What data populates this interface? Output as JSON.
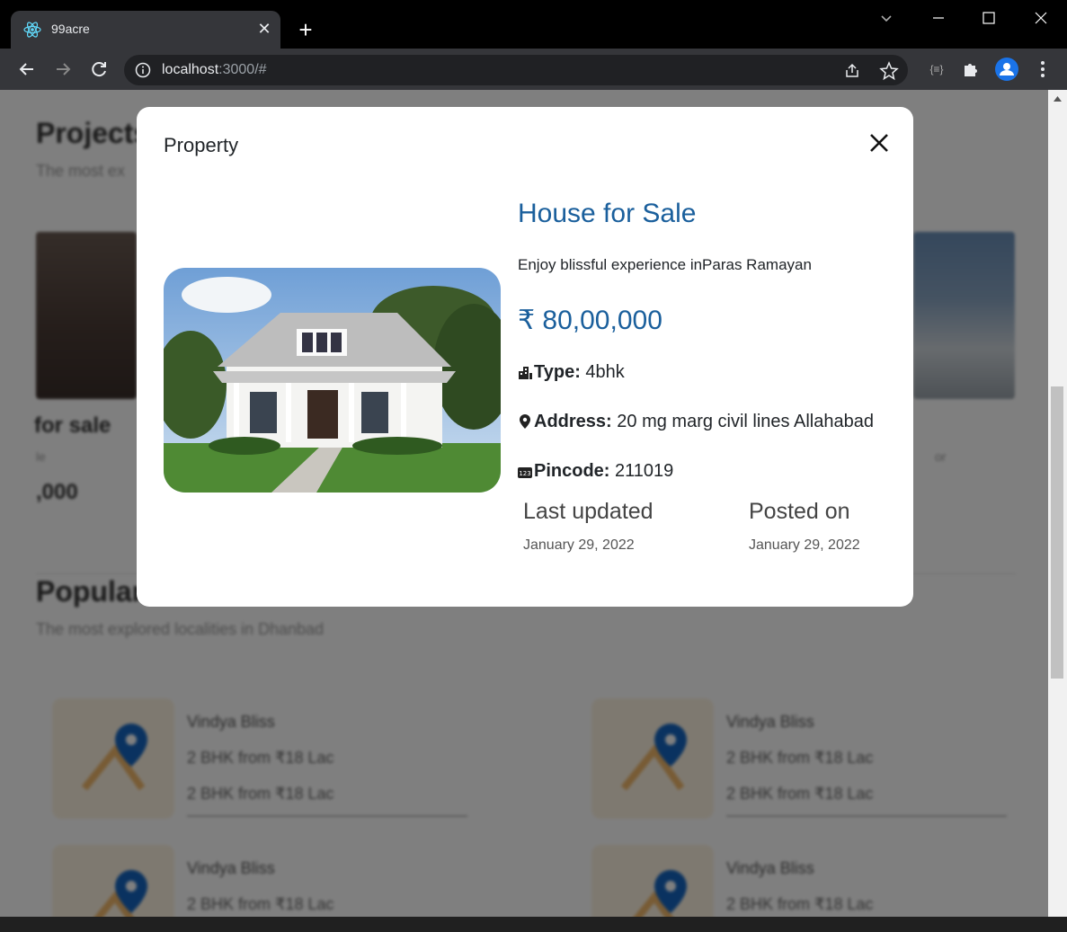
{
  "browser": {
    "tab_title": "99acre",
    "url_host": "localhost",
    "url_rest": ":3000/#"
  },
  "background": {
    "section1_title": "Projects",
    "section1_sub": "The most ex",
    "card_left_title": "for sale",
    "card_left_sub": "le",
    "card_left_price": ",000",
    "card_right_sub": "or",
    "section2_title": "Popular",
    "section2_sub": "The most explored localities in Dhanbad",
    "localities": [
      {
        "name": "Vindya Bliss",
        "line1": "2 BHK from ₹18 Lac",
        "line2": "2 BHK from ₹18 Lac"
      },
      {
        "name": "Vindya Bliss",
        "line1": "2 BHK from ₹18 Lac",
        "line2": "2 BHK from ₹18 Lac"
      },
      {
        "name": "Vindya Bliss",
        "line1": "2 BHK from ₹18 Lac",
        "line2": ""
      },
      {
        "name": "Vindya Bliss",
        "line1": "2 BHK from ₹18 Lac",
        "line2": ""
      }
    ]
  },
  "modal": {
    "title": "Property",
    "heading": "House for Sale",
    "description": "Enjoy blissful experience inParas Ramayan",
    "price": "₹ 80,00,000",
    "type_label": "Type:",
    "type_value": "4bhk",
    "address_label": "Address:",
    "address_value": "20 mg marg civil lines Allahabad",
    "pincode_label": "Pincode:",
    "pincode_value": "211019",
    "last_updated_label": "Last updated",
    "last_updated_value": "January 29, 2022",
    "posted_on_label": "Posted on",
    "posted_on_value": "January 29, 2022"
  },
  "colors": {
    "accent": "#1a5f9c",
    "overlay": "rgba(0,0,0,0.5)"
  }
}
